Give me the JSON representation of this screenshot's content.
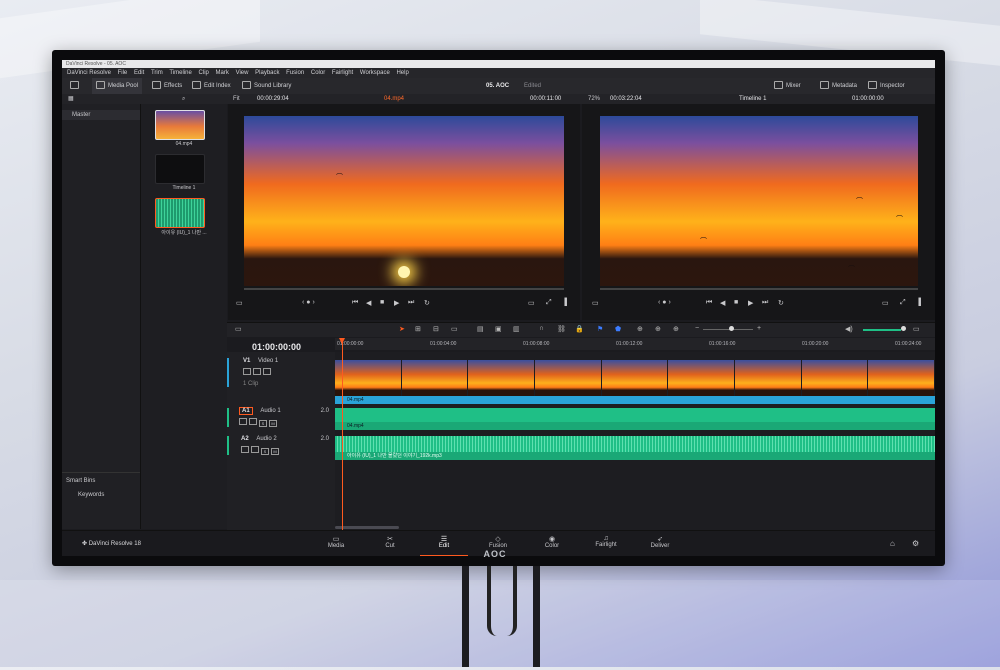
{
  "window": {
    "title": "DaVinci Resolve - 05. AOC"
  },
  "menu": [
    "DaVinci Resolve",
    "File",
    "Edit",
    "Trim",
    "Timeline",
    "Clip",
    "Mark",
    "View",
    "Playback",
    "Fusion",
    "Color",
    "Fairlight",
    "Workspace",
    "Help"
  ],
  "toolbar": {
    "media_pool": "Media Pool",
    "effects": "Effects",
    "edit_index": "Edit Index",
    "sound_library": "Sound Library",
    "project_name": "05. AOC",
    "project_status": "Edited",
    "mixer": "Mixer",
    "metadata": "Metadata",
    "inspector": "Inspector"
  },
  "source_viewer": {
    "fit": "Fit",
    "timecode_left": "00:00:29:04",
    "clip_name": "04.mp4",
    "timecode_right": "00:00:11:00"
  },
  "timeline_viewer": {
    "zoom": "72%",
    "timecode_left": "00:03:22:04",
    "timeline_name": "Timeline 1",
    "timecode_right": "01:00:00:00"
  },
  "bins": {
    "master": "Master",
    "smart_bins": "Smart Bins",
    "keywords": "Keywords"
  },
  "clips": [
    {
      "name": "04.mp4"
    },
    {
      "name": "Timeline 1"
    },
    {
      "name": "아이유 (IU)_1 나만 ..."
    }
  ],
  "timeline": {
    "timecode": "01:00:00:00",
    "ruler": [
      "01:00:00:00",
      "01:00:04:00",
      "01:00:08:00",
      "01:00:12:00",
      "01:00:16:00",
      "01:00:20:00",
      "01:00:24:00"
    ],
    "tracks": {
      "v1": {
        "id": "V1",
        "name": "Video 1",
        "info": "1 Clip",
        "clip": "04.mp4"
      },
      "a1": {
        "id": "A1",
        "name": "Audio 1",
        "channels": "2.0",
        "clip": "04.mp4"
      },
      "a2": {
        "id": "A2",
        "name": "Audio 2",
        "channels": "2.0",
        "clip": "아이유 (IU)_1 나만 몰랐던 이야기_192k.mp3"
      }
    }
  },
  "pages": [
    "Media",
    "Cut",
    "Edit",
    "Fusion",
    "Color",
    "Fairlight",
    "Deliver"
  ],
  "active_page": "Edit",
  "app_logo": "DaVinci Resolve 18",
  "monitor_brand": "AOC",
  "colors": {
    "accent": "#ff5a1f",
    "video_clip": "#2aa3d8",
    "audio_clip": "#1fbf86"
  }
}
